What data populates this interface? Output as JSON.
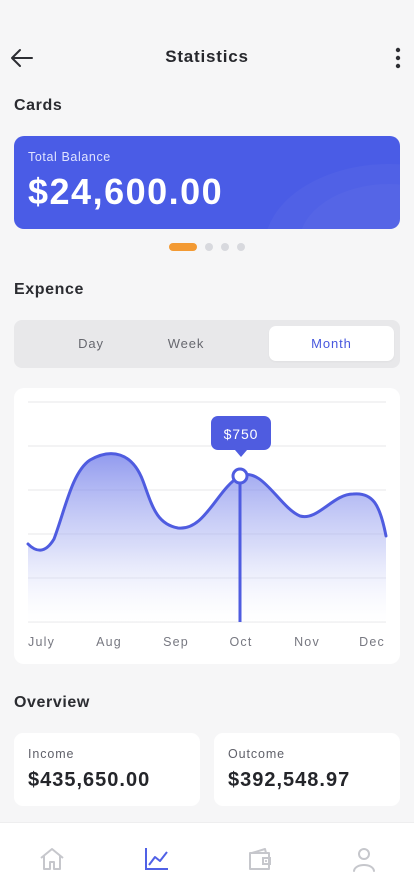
{
  "header": {
    "title": "Statistics"
  },
  "cards_section": {
    "title": "Cards"
  },
  "balance_card": {
    "label": "Total Balance",
    "value": "$24,600.00",
    "color": "#4a5ce6"
  },
  "pager": {
    "count": 4,
    "active_index": 0,
    "active_color": "#f39a33"
  },
  "expense_section": {
    "title": "Expence"
  },
  "period_tabs": {
    "items": [
      "Day",
      "Week",
      "Month"
    ],
    "selected": "Month"
  },
  "chart_data": {
    "type": "area",
    "categories": [
      "July",
      "Aug",
      "Sep",
      "Oct",
      "Nov",
      "Dec"
    ],
    "selected_category": "Oct",
    "selected_value_label": "$750",
    "line_color": "#4f5ce0",
    "grid": true
  },
  "overview_section": {
    "title": "Overview"
  },
  "overview": {
    "income": {
      "label": "Income",
      "value": "$435,650.00"
    },
    "outcome": {
      "label": "Outcome",
      "value": "$392,548.97"
    }
  },
  "bottom_nav": {
    "items": [
      {
        "icon": "home-icon"
      },
      {
        "icon": "chart-icon"
      },
      {
        "icon": "wallet-icon"
      },
      {
        "icon": "profile-icon"
      }
    ],
    "active_index": 1,
    "active_color": "#5061e6",
    "inactive_color": "#c6c7cc"
  }
}
